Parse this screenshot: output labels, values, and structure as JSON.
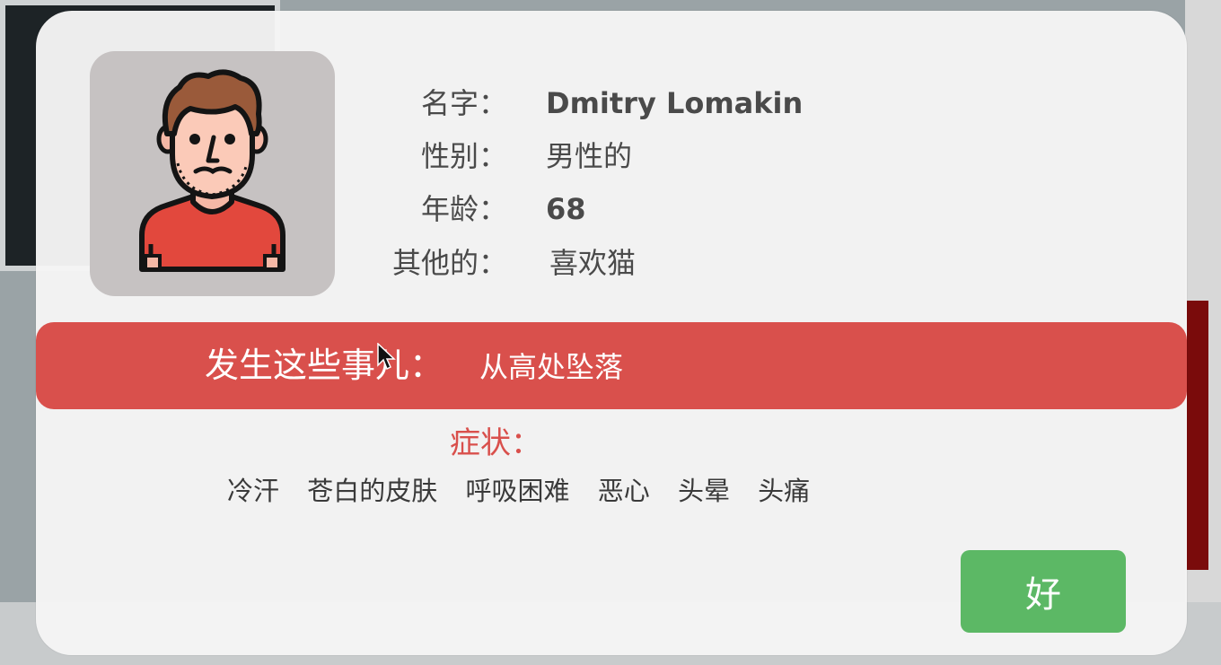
{
  "patient": {
    "name_label": "名字：",
    "name_value": "Dmitry Lomakin",
    "gender_label": "性别：",
    "gender_value": "男性的",
    "age_label": "年龄：",
    "age_value": "68",
    "other_label": "其他的：",
    "other_value": "喜欢猫"
  },
  "event": {
    "label": "发生这些事儿：",
    "value": "从高处坠落"
  },
  "symptoms": {
    "title": "症状：",
    "items": [
      "冷汗",
      "苍白的皮肤",
      "呼吸困难",
      "恶心",
      "头晕",
      "头痛"
    ]
  },
  "buttons": {
    "ok_label": "好"
  },
  "colors": {
    "event_bar": "#d9504c",
    "ok_button": "#5cb865",
    "avatar_bg": "#c6c2c2"
  },
  "icons": {
    "avatar": "patient-avatar-icon",
    "cursor": "mouse-pointer-icon"
  }
}
